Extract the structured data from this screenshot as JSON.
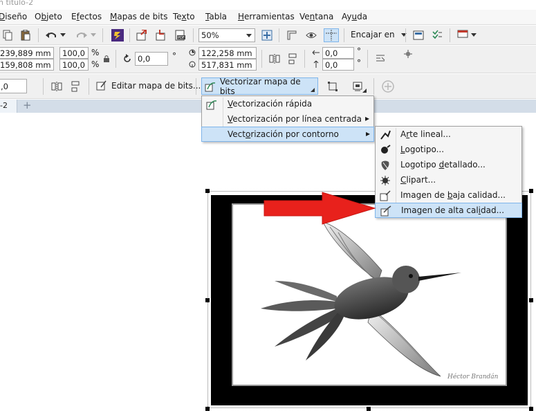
{
  "title_bar": {
    "text": "n título-2"
  },
  "menu_bar": {
    "items": [
      {
        "pre": "",
        "ul": "D",
        "post": "iseño"
      },
      {
        "pre": "O",
        "ul": "b",
        "post": "jeto"
      },
      {
        "pre": "E",
        "ul": "f",
        "post": "ectos"
      },
      {
        "pre": "",
        "ul": "M",
        "post": "apas de bits"
      },
      {
        "pre": "Te",
        "ul": "x",
        "post": "to"
      },
      {
        "pre": "",
        "ul": "T",
        "post": "abla"
      },
      {
        "pre": "",
        "ul": "H",
        "post": "erramientas"
      },
      {
        "pre": "Ve",
        "ul": "n",
        "post": "tana"
      },
      {
        "pre": "Ay",
        "ul": "u",
        "post": "da"
      }
    ]
  },
  "standard_toolbar": {
    "zoom_value": "50%",
    "snap_label": "Encajar en"
  },
  "property_bar": {
    "x_pos": "239,889 mm",
    "y_pos": "159,808 mm",
    "scale_x": "100,0",
    "scale_y": "100,0",
    "percent": "%",
    "rotation": "0,0",
    "degree": "°",
    "width": "122,258 mm",
    "height": "517,831 mm",
    "skew_h": "0,0",
    "skew_v": "0,0"
  },
  "bitmap_toolbar": {
    "outline_value": ",0",
    "edit_bitmap_label": "Editar mapa de bits...",
    "trace_bitmap_label": "Vectorizar mapa de bits"
  },
  "document_tabs": {
    "active": "-2",
    "add": "+"
  },
  "trace_menu": {
    "items": [
      {
        "pre": "",
        "ul": "V",
        "post": "ectorización rápida",
        "arrow": ""
      },
      {
        "pre": "",
        "ul": "V",
        "post": "ectorización por línea centrada",
        "arrow": "▸"
      },
      {
        "pre": "Vect",
        "ul": "o",
        "post": "rización por contorno",
        "arrow": "▸"
      }
    ]
  },
  "outline_submenu": {
    "items": [
      {
        "pre": "A",
        "ul": "r",
        "post": "te lineal..."
      },
      {
        "pre": "",
        "ul": "L",
        "post": "ogotipo..."
      },
      {
        "pre": "Logotipo ",
        "ul": "d",
        "post": "etallado..."
      },
      {
        "pre": "",
        "ul": "C",
        "post": "lipart..."
      },
      {
        "pre": "Imagen de ",
        "ul": "b",
        "post": "aja calidad..."
      },
      {
        "pre": "Imagen de alta cal",
        "ul": "i",
        "post": "dad..."
      }
    ]
  },
  "image": {
    "signature": "Héctor Brandán"
  },
  "colors": {
    "menu_highlight": "#cde3f7",
    "highlight_border": "#7eb4ea",
    "arrow_red": "#e8211c",
    "toolbar_bg": "#f0f0f0"
  }
}
